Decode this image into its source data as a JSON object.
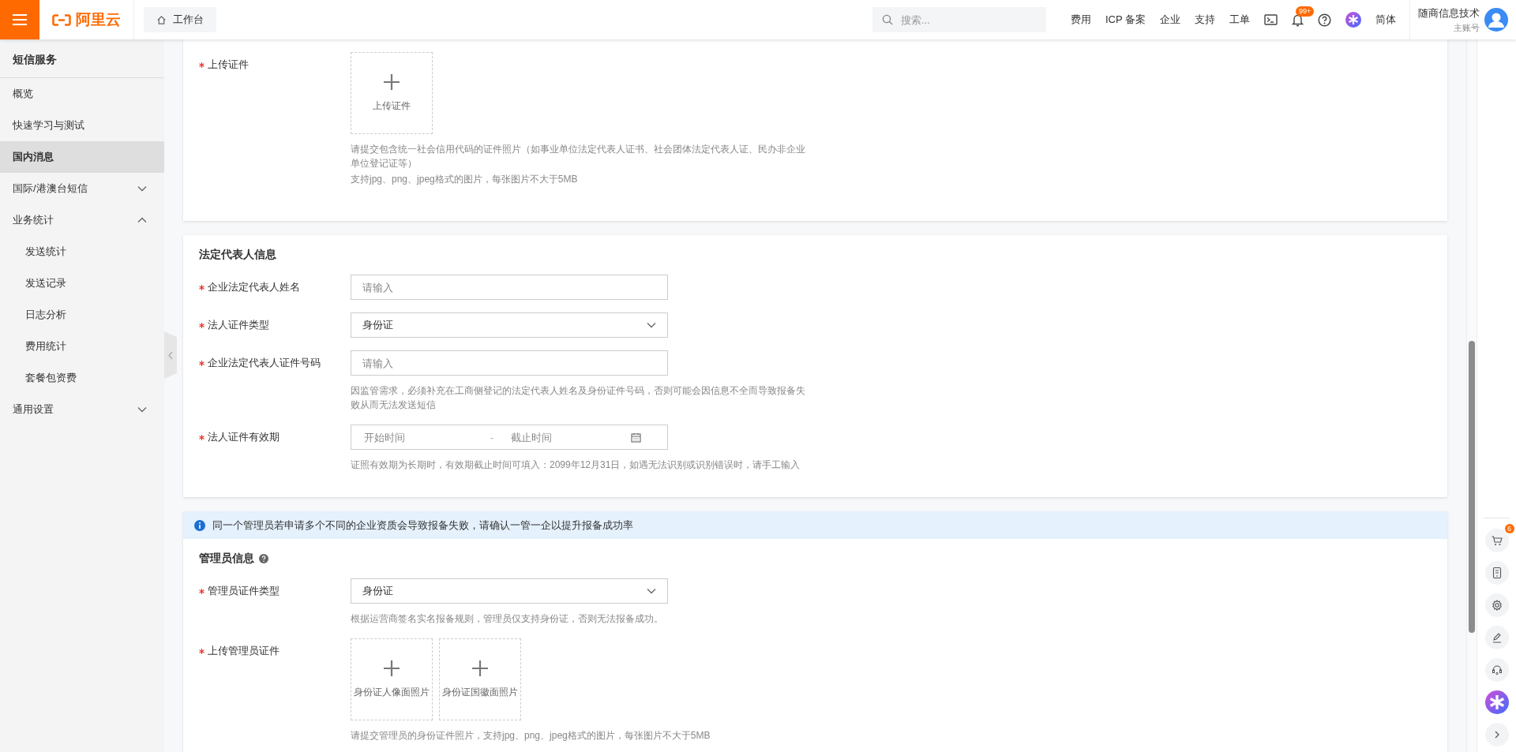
{
  "topbar": {
    "logo": "阿里云",
    "workbench": "工作台",
    "search": {
      "placeholder": "搜索..."
    },
    "links": [
      "费用",
      "ICP 备案",
      "企业",
      "支持",
      "工单"
    ],
    "notification_badge": "99+",
    "language": "简体",
    "account": {
      "name": "随商信息技术",
      "role": "主账号"
    }
  },
  "sidebar": {
    "title": "短信服务",
    "items": [
      {
        "label": "概览",
        "selected": false
      },
      {
        "label": "快速学习与测试",
        "selected": false
      },
      {
        "label": "国内消息",
        "selected": true
      },
      {
        "label": "国际/港澳台短信",
        "selected": false,
        "expanded": false
      },
      {
        "label": "业务统计",
        "selected": false,
        "expanded": true,
        "children": [
          {
            "label": "发送统计",
            "selected": false
          },
          {
            "label": "发送记录",
            "selected": false
          },
          {
            "label": "日志分析",
            "selected": false
          },
          {
            "label": "费用统计",
            "selected": false
          },
          {
            "label": "套餐包资费",
            "selected": false
          }
        ]
      },
      {
        "label": "通用设置",
        "selected": false,
        "expanded": false
      }
    ]
  },
  "sections": [
    {
      "fields": [
        {
          "kind": "upload",
          "label": "上传证件",
          "required": true,
          "tiles": [
            "上传证件"
          ],
          "hints": [
            "请提交包含统一社会信用代码的证件照片（如事业单位法定代表人证书、社会团体法定代表人证、民办非企业单位登记证等）",
            "支持jpg、png、jpeg格式的图片，每张图片不大于5MB"
          ]
        }
      ]
    },
    {
      "title": "法定代表人信息",
      "fields": [
        {
          "kind": "input",
          "label": "企业法定代表人姓名",
          "required": true,
          "placeholder": "请输入"
        },
        {
          "kind": "select",
          "label": "法人证件类型",
          "required": true,
          "value": "身份证"
        },
        {
          "kind": "input",
          "label": "企业法定代表人证件号码",
          "required": true,
          "placeholder": "请输入",
          "hints": [
            "因监管需求，必须补充在工商侧登记的法定代表人姓名及身份证件号码，否则可能会因信息不全而导致报备失败从而无法发送短信"
          ]
        },
        {
          "kind": "date_range",
          "label": "法人证件有效期",
          "required": true,
          "start_placeholder": "开始时间",
          "separator": "-",
          "end_placeholder": "截止时间",
          "hints": [
            "证照有效期为长期时，有效期截止时间可填入：2099年12月31日，如遇无法识别或识别错误时，请手工输入"
          ]
        }
      ]
    },
    {
      "banner": "同一个管理员若申请多个不同的企业资质会导致报备失败，请确认一管一企以提升报备成功率",
      "title": "管理员信息",
      "title_help": true,
      "fields": [
        {
          "kind": "select",
          "label": "管理员证件类型",
          "required": true,
          "value": "身份证",
          "hints": [
            "根据运营商签名实名报备规则，管理员仅支持身份证，否则无法报备成功。"
          ]
        },
        {
          "kind": "upload",
          "label": "上传管理员证件",
          "required": true,
          "tiles": [
            "身份证人像面照片",
            "身份证国徽面照片"
          ],
          "hints": [
            "请提交管理员的身份证件照片，支持jpg、png、jpeg格式的图片，每张图片不大于5MB"
          ]
        }
      ]
    }
  ],
  "right_rail": {
    "cart_badge": "6"
  }
}
